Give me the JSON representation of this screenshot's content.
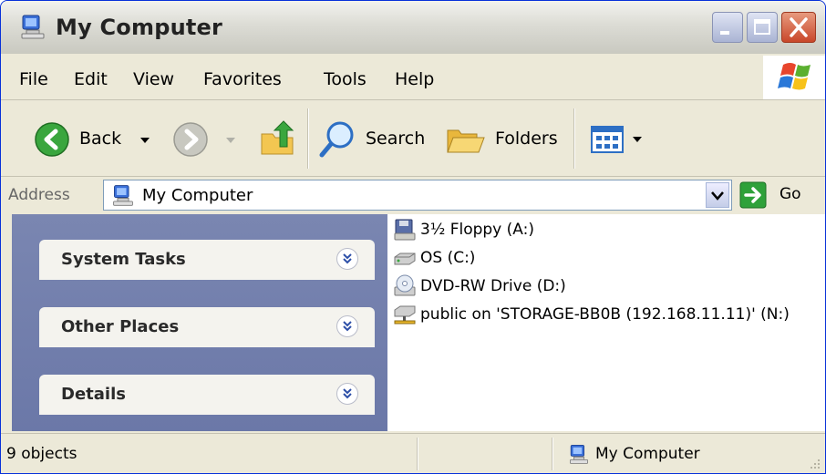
{
  "window": {
    "title": "My Computer",
    "icon": "my-computer-icon",
    "controls": [
      "minimize",
      "maximize",
      "close"
    ]
  },
  "menu": {
    "items": [
      "File",
      "Edit",
      "View",
      "Favorites",
      "Tools",
      "Help"
    ]
  },
  "toolbar": {
    "back_label": "Back",
    "search_label": "Search",
    "folders_label": "Folders"
  },
  "address": {
    "label": "Address",
    "value": "My Computer",
    "go_label": "Go"
  },
  "task_panels": [
    {
      "title": "System Tasks"
    },
    {
      "title": "Other Places"
    },
    {
      "title": "Details"
    }
  ],
  "drives": [
    {
      "label": "3½ Floppy (A:)",
      "icon": "floppy-drive-icon"
    },
    {
      "label": "OS (C:)",
      "icon": "hard-drive-icon"
    },
    {
      "label": "DVD-RW Drive (D:)",
      "icon": "dvd-drive-icon"
    },
    {
      "label": "public on 'STORAGE-BB0B (192.168.11.11)' (N:)",
      "icon": "network-drive-icon"
    }
  ],
  "status": {
    "count": "9 objects",
    "location": "My Computer"
  },
  "colors": {
    "title_bar": "#dcdcd5",
    "task_pane": "#7a86b1",
    "go_green": "#2fa13a",
    "close_red": "#c9472a"
  }
}
